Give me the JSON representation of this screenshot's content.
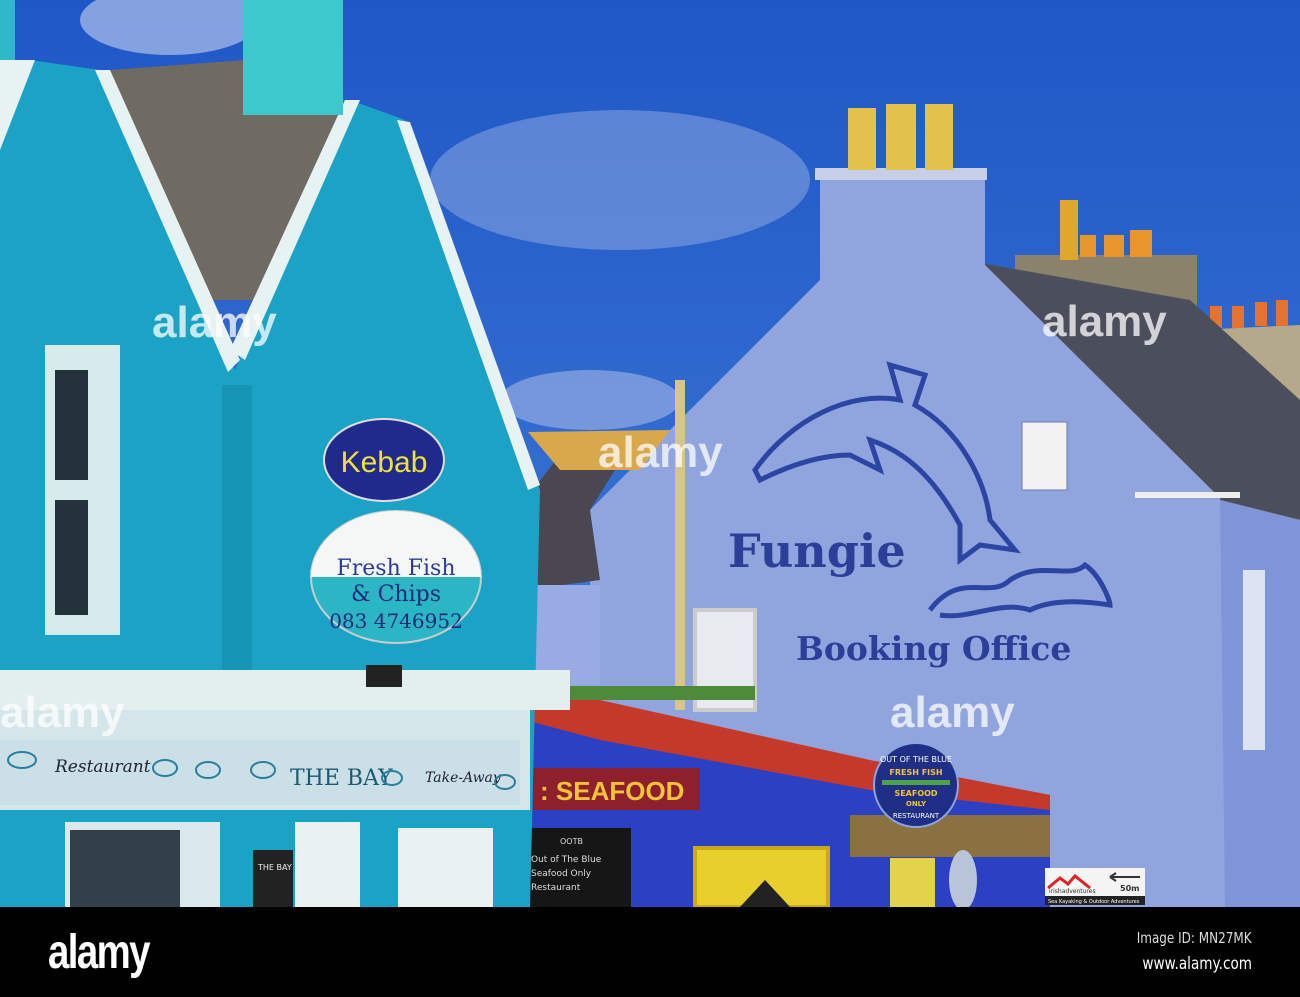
{
  "signs": {
    "kebab": "Kebab",
    "fish_line1": "Fresh Fish",
    "fish_line2": "& Chips",
    "fish_phone": "083 4746952",
    "mural_title": "Fungie",
    "mural_subtitle": "Booking Office",
    "fascia_restaurant": "Restaurant",
    "fascia_name": "THE BAY",
    "fascia_takeaway": "Take-Away",
    "seafood_banner": ": SEAFOOD",
    "round_sign": [
      "OUT OF THE BLUE",
      "FRESH FISH",
      "SEAFOOD",
      "ONLY",
      "RESTAURANT"
    ],
    "chalkboard": [
      "OOTB",
      "Out of The Blue",
      "Seafood Only",
      "Restaurant"
    ],
    "small_board": "THE BAY",
    "direction_sign_brand": "irishadventures",
    "direction_sign_distance": "50m",
    "direction_sign_tagline": "Sea Kayaking & Outdoor Adventures"
  },
  "watermark": "alamy",
  "footer": {
    "logo": "alamy",
    "image_id": "Image ID: MN27MK",
    "website": "www.alamy.com"
  },
  "colors": {
    "sky": "#2a62cc",
    "turquoise_building": "#1ba3c6",
    "fungie_wall": "#90a5de",
    "seafood_shop": "#2c40c4"
  }
}
